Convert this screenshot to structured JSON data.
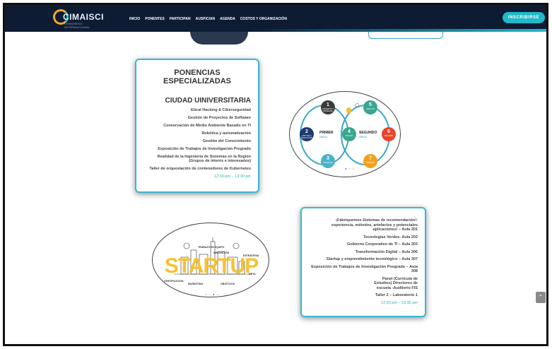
{
  "header": {
    "logo_text": "CIMAISCI",
    "logo_sub": "CONGRESO INTERNACIONAL",
    "nav": [
      "INICIO",
      "PONENTES",
      "PARTICIPAN",
      "AUSPICIAN",
      "AGENDA",
      "COSTOS Y ORGANIZACIÓN"
    ],
    "cta_label": "INSCRIBIRSE"
  },
  "card1": {
    "title": "PONENCIAS ESPECIALIZADAS",
    "subtitle": "CIUDAD UINIVERSITARIA",
    "topics": [
      "Etical Hacking & Ciberseguridad",
      "Gestión de Proyectos de Software",
      "Conservación de Medio Ambiente Basado en TI",
      "Robótica y  automatización",
      "Gestión del Conocimiento",
      "Exposición de Trabajos de Investigación Pregrado",
      "Realidad de la Ingeniería de Sistemas en la Región (Grupos de interés e interesados)",
      "Taller de orquestación de contenedores de Kubernetes"
    ],
    "time": "12:30 pm – 13:30 pm"
  },
  "card2": {
    "topics": [
      "¡Fabriquemos Sistemas de recomendación!: experiencia, métodos, artefactos y potenciales aplicaciones! – Aula 201",
      "Tecnologías Verdes- Aula 202",
      "Gobierno Corporativo de TI – Aula 203",
      "Transformación Digital – Aula 306",
      "Startup y emprendimiento tecnológico – Aula 307",
      "Exposición de Trabajos de Investigación Posgrado – Aula 308",
      "Panel (Currícula de Estudios) Directores de escuela -Auditorio FIS",
      "Taller 2 – Laboratorio 1"
    ],
    "time": "12:30 pm – 13:30 pm"
  },
  "cycle_diagram": {
    "label_first": "PRIMER",
    "label_first_sub": "CICLO",
    "label_second": "SEGUNDO",
    "label_second_sub": "CICLO",
    "nodes": [
      {
        "num": "1",
        "text": "CONCEPTO Y PROBLEMA",
        "color": "#3a3a3a"
      },
      {
        "num": "2",
        "text": "CAPTURA Y RESOLUCIÓN",
        "color": "#1d3b6b"
      },
      {
        "num": "3",
        "text": "CONTEXTO",
        "color": "#4bb3c7"
      },
      {
        "num": "4",
        "text": "APLICAR",
        "color": "#3aa68e"
      },
      {
        "num": "5",
        "text": "EVALUAR",
        "color": "#3aa68e"
      },
      {
        "num": "6",
        "text": "MEJORAR",
        "color": "#e8452c"
      },
      {
        "num": "7",
        "text": "DIFUSIÓN",
        "color": "#f2a01c"
      }
    ]
  },
  "startup_graphic": {
    "word": "STARTUP",
    "tags": [
      "TRABAJO EN EQUIPO",
      "INNOVACIÓN",
      "ESTRATEGIA",
      "META",
      "CERTIFICACIÓN",
      "MARKETING",
      "OBJETIVOS"
    ]
  },
  "scroll_top_icon": "chevron-up-icon"
}
